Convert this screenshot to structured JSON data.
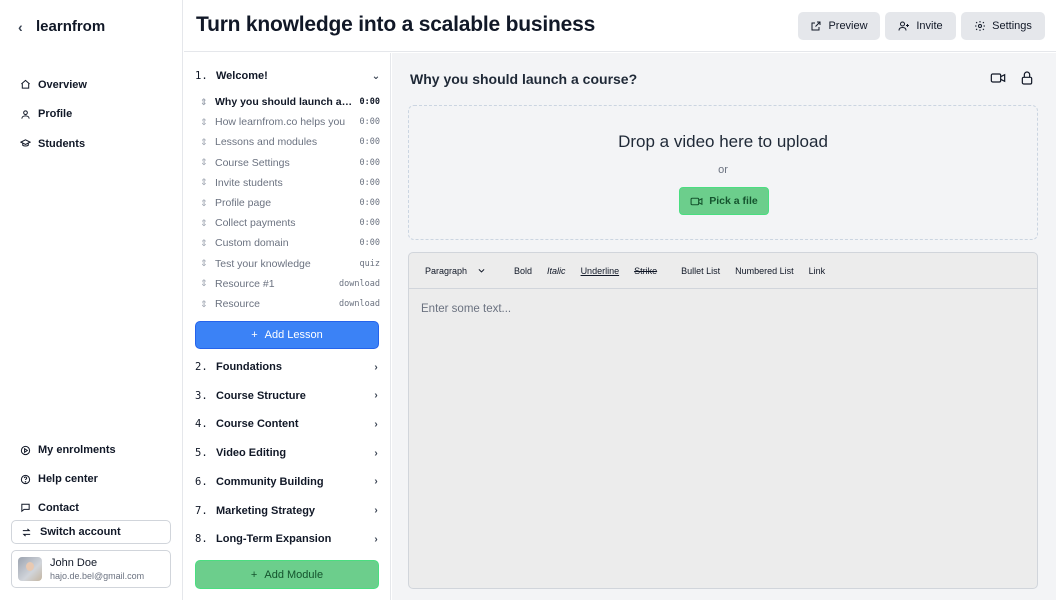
{
  "app": {
    "brand": "learnfrom"
  },
  "sidebar": {
    "nav": [
      {
        "label": "Overview",
        "icon": "home-icon"
      },
      {
        "label": "Profile",
        "icon": "user-icon"
      },
      {
        "label": "Students",
        "icon": "graduation-cap-icon"
      }
    ],
    "bottom_nav": [
      {
        "label": "My enrolments",
        "icon": "play-circle-icon"
      },
      {
        "label": "Help center",
        "icon": "help-circle-icon"
      },
      {
        "label": "Contact",
        "icon": "chat-icon"
      }
    ],
    "switch_account": "Switch account",
    "user": {
      "name": "John Doe",
      "email": "hajo.de.bel@gmail.com"
    }
  },
  "header": {
    "title": "Turn knowledge into a scalable business",
    "buttons": {
      "preview": "Preview",
      "invite": "Invite",
      "settings": "Settings"
    }
  },
  "curriculum": {
    "modules": [
      {
        "num": "1.",
        "title": "Welcome!",
        "expanded": true
      },
      {
        "num": "2.",
        "title": "Foundations"
      },
      {
        "num": "3.",
        "title": "Course Structure"
      },
      {
        "num": "4.",
        "title": "Course Content"
      },
      {
        "num": "5.",
        "title": "Video Editing"
      },
      {
        "num": "6.",
        "title": "Community Building"
      },
      {
        "num": "7.",
        "title": "Marketing Strategy"
      },
      {
        "num": "8.",
        "title": "Long-Term Expansion"
      }
    ],
    "lessons": [
      {
        "title": "Why you should launch a course?",
        "meta": "0:00",
        "active": true
      },
      {
        "title": "How learnfrom.co helps you",
        "meta": "0:00"
      },
      {
        "title": "Lessons and modules",
        "meta": "0:00"
      },
      {
        "title": "Course Settings",
        "meta": "0:00"
      },
      {
        "title": "Invite students",
        "meta": "0:00"
      },
      {
        "title": "Profile page",
        "meta": "0:00"
      },
      {
        "title": "Collect payments",
        "meta": "0:00"
      },
      {
        "title": "Custom domain",
        "meta": "0:00"
      },
      {
        "title": "Test your knowledge",
        "meta": "quiz"
      },
      {
        "title": "Resource #1",
        "meta": "download"
      },
      {
        "title": "Resource",
        "meta": "download"
      }
    ],
    "add_lesson": "Add Lesson",
    "add_module": "Add Module"
  },
  "editor": {
    "lesson_title": "Why you should launch a course?",
    "dropzone": {
      "title": "Drop a video here to upload",
      "or": "or",
      "pick": "Pick a file"
    },
    "toolbar": {
      "style": "Paragraph",
      "bold": "Bold",
      "italic": "Italic",
      "underline": "Underline",
      "strike": "Strike",
      "bullet": "Bullet List",
      "numbered": "Numbered List",
      "link": "Link"
    },
    "placeholder": "Enter some text..."
  },
  "colors": {
    "primary_blue": "#3b82f6",
    "success_green": "#6cce8c",
    "pane_bg": "#f3f4f6"
  }
}
